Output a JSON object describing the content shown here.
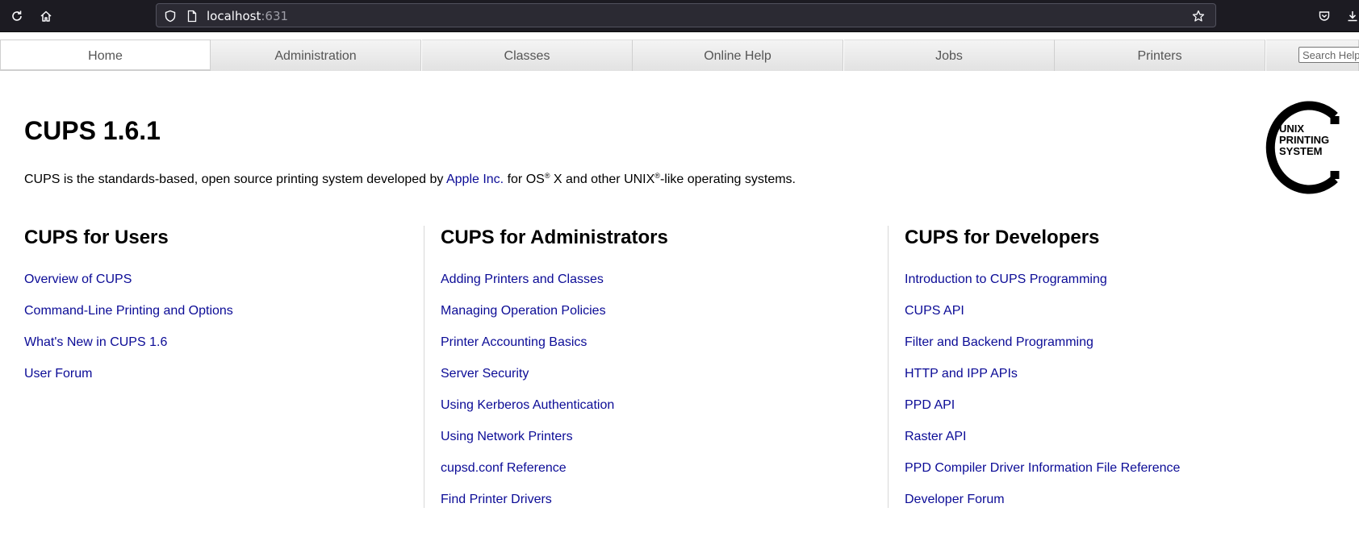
{
  "browser": {
    "url_host": "localhost",
    "url_port": ":631",
    "icons": [
      "reload-icon",
      "home-icon",
      "shield-icon",
      "page-icon",
      "star-icon",
      "pocket-icon",
      "download-icon"
    ]
  },
  "nav": {
    "tabs": [
      {
        "label": "Home",
        "active": true
      },
      {
        "label": "Administration",
        "active": false
      },
      {
        "label": "Classes",
        "active": false
      },
      {
        "label": "Online Help",
        "active": false
      },
      {
        "label": "Jobs",
        "active": false
      },
      {
        "label": "Printers",
        "active": false
      }
    ],
    "search_placeholder": "Search Help"
  },
  "header": {
    "title": "CUPS 1.6.1",
    "intro_before": "CUPS is the standards-based, open source printing system developed by ",
    "intro_link": "Apple Inc.",
    "intro_mid1": " for OS",
    "intro_reg": "®",
    "intro_mid2": " X and other UNIX",
    "intro_reg2": "®",
    "intro_after": "-like operating systems."
  },
  "logo": {
    "line1": "UNIX",
    "line2": "PRINTING",
    "line3": "SYSTEM"
  },
  "columns": [
    {
      "heading": "CUPS for Users",
      "links": [
        "Overview of CUPS",
        "Command-Line Printing and Options",
        "What's New in CUPS 1.6",
        "User Forum"
      ]
    },
    {
      "heading": "CUPS for Administrators",
      "links": [
        "Adding Printers and Classes",
        "Managing Operation Policies",
        "Printer Accounting Basics",
        "Server Security",
        "Using Kerberos Authentication",
        "Using Network Printers",
        "cupsd.conf Reference",
        "Find Printer Drivers"
      ]
    },
    {
      "heading": "CUPS for Developers",
      "links": [
        "Introduction to CUPS Programming",
        "CUPS API",
        "Filter and Backend Programming",
        "HTTP and IPP APIs",
        "PPD API",
        "Raster API",
        "PPD Compiler Driver Information File Reference",
        "Developer Forum"
      ]
    }
  ],
  "colors": {
    "link": "#0b0b96",
    "chrome_bg": "#1c1b22",
    "urlbar_bg": "#2b2a33"
  }
}
